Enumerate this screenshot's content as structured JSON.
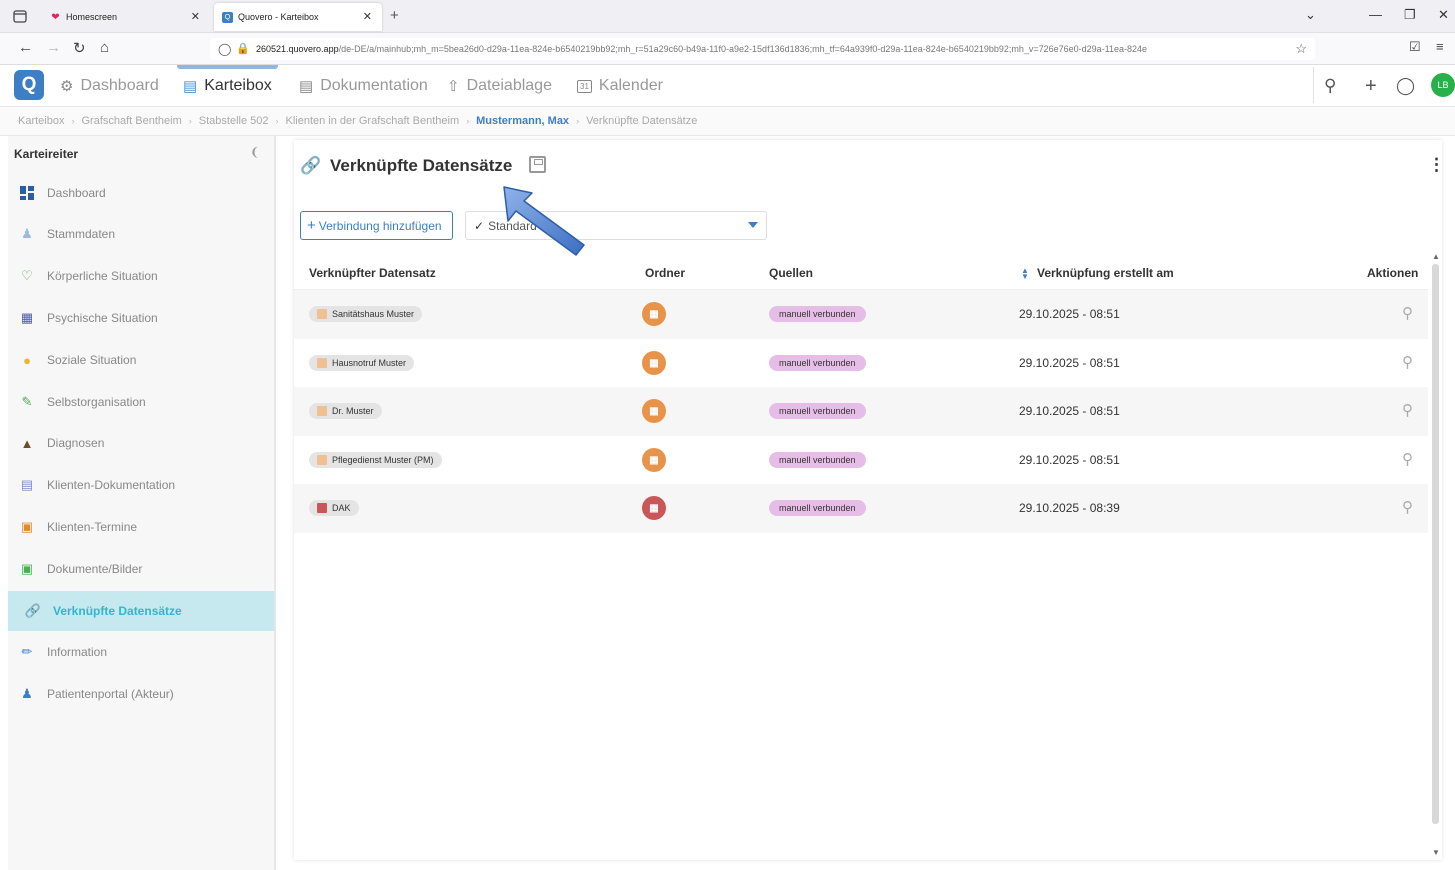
{
  "browser": {
    "tabs": [
      {
        "label": "Homescreen",
        "icon": "heart-icon",
        "color": "#e0245e"
      },
      {
        "label": "Quovero - Karteibox",
        "icon": "quovero-favicon",
        "active": true
      }
    ],
    "url_domain": "260521.quovero.app",
    "url_rest": "/de-DE/a/mainhub;mh_m=5bea26d0-d29a-11ea-824e-b6540219bb92;mh_r=51a29c60-b49a-11f0-a9e2-15df136d1836;mh_tf=64a939f0-d29a-11ea-824e-b6540219bb92;mh_v=726e76e0-d29a-11ea-824e"
  },
  "app": {
    "nav": [
      {
        "label": "Dashboard",
        "icon": "dashboard-icon"
      },
      {
        "label": "Karteibox",
        "icon": "karteibox-icon",
        "active": true
      },
      {
        "label": "Dokumentation",
        "icon": "document-icon"
      },
      {
        "label": "Dateiablage",
        "icon": "file-upload-icon"
      },
      {
        "label": "Kalender",
        "icon": "calendar-icon",
        "icon_text": "31"
      }
    ],
    "avatar_initials": "LB",
    "brand_color": "#3d7fc4"
  },
  "breadcrumb": [
    "Karteibox",
    "Grafschaft Bentheim",
    "Stabstelle 502",
    "Klienten in der Grafschaft Bentheim",
    "Mustermann, Max",
    "Verknüpfte Datensätze"
  ],
  "sidebar": {
    "title": "Karteireiter",
    "items": [
      {
        "label": "Dashboard",
        "icon": "dashboard-grid-icon",
        "color": "#2c5f9e"
      },
      {
        "label": "Stammdaten",
        "icon": "person-icon",
        "color": "#9fb8e0"
      },
      {
        "label": "Körperliche Situation",
        "icon": "heartbeat-icon",
        "color": "#4caf50"
      },
      {
        "label": "Psychische Situation",
        "icon": "brain-icon",
        "color": "#4a5aa8"
      },
      {
        "label": "Soziale Situation",
        "icon": "people-icon",
        "color": "#f0b429"
      },
      {
        "label": "Selbstorganisation",
        "icon": "edit-square-icon",
        "color": "#4caf50"
      },
      {
        "label": "Diagnosen",
        "icon": "chart-area-icon",
        "color": "#6b4f2a"
      },
      {
        "label": "Klienten-Dokumentation",
        "icon": "document-icon",
        "color": "#7a8fc8"
      },
      {
        "label": "Klienten-Termine",
        "icon": "calendar-icon",
        "color": "#e08a2a"
      },
      {
        "label": "Dokumente/Bilder",
        "icon": "image-icon",
        "color": "#4caf50"
      },
      {
        "label": "Verknüpfte Datensätze",
        "icon": "link-icon",
        "color": "#36b4cf",
        "active": true
      },
      {
        "label": "Information",
        "icon": "pencil-icon",
        "color": "#3d7fc4"
      },
      {
        "label": "Patientenportal (Akteur)",
        "icon": "users-icon",
        "color": "#3d7fc4"
      }
    ]
  },
  "main": {
    "title": "Verknüpfte Datensätze",
    "add_button": "Verbindung hinzufügen",
    "view_selector": "Standard",
    "columns": {
      "record": "Verknüpfter Datensatz",
      "folder": "Ordner",
      "sources": "Quellen",
      "created": "Verknüpfung erstellt am",
      "actions": "Aktionen"
    },
    "rows": [
      {
        "name": "Sanitätshaus Muster",
        "folder_color": "#e8934a",
        "folder_icon": "building-icon",
        "source": "manuell verbunden",
        "date": "29.10.2025 - 08:51"
      },
      {
        "name": "Hausnotruf Muster",
        "folder_color": "#e8934a",
        "folder_icon": "building-icon",
        "source": "manuell verbunden",
        "date": "29.10.2025 - 08:51"
      },
      {
        "name": "Dr. Muster",
        "folder_color": "#e8934a",
        "folder_icon": "building-icon",
        "source": "manuell verbunden",
        "date": "29.10.2025 - 08:51"
      },
      {
        "name": "Pflegedienst Muster (PM)",
        "folder_color": "#e8934a",
        "folder_icon": "building-icon",
        "source": "manuell verbunden",
        "date": "29.10.2025 - 08:51"
      },
      {
        "name": "DAK",
        "folder_color": "#c9575a",
        "folder_icon": "insurance-icon",
        "source": "manuell verbunden",
        "date": "29.10.2025 - 08:39"
      }
    ]
  },
  "annotation": {
    "type": "pointer-arrow",
    "color": "#4a7fd0"
  }
}
